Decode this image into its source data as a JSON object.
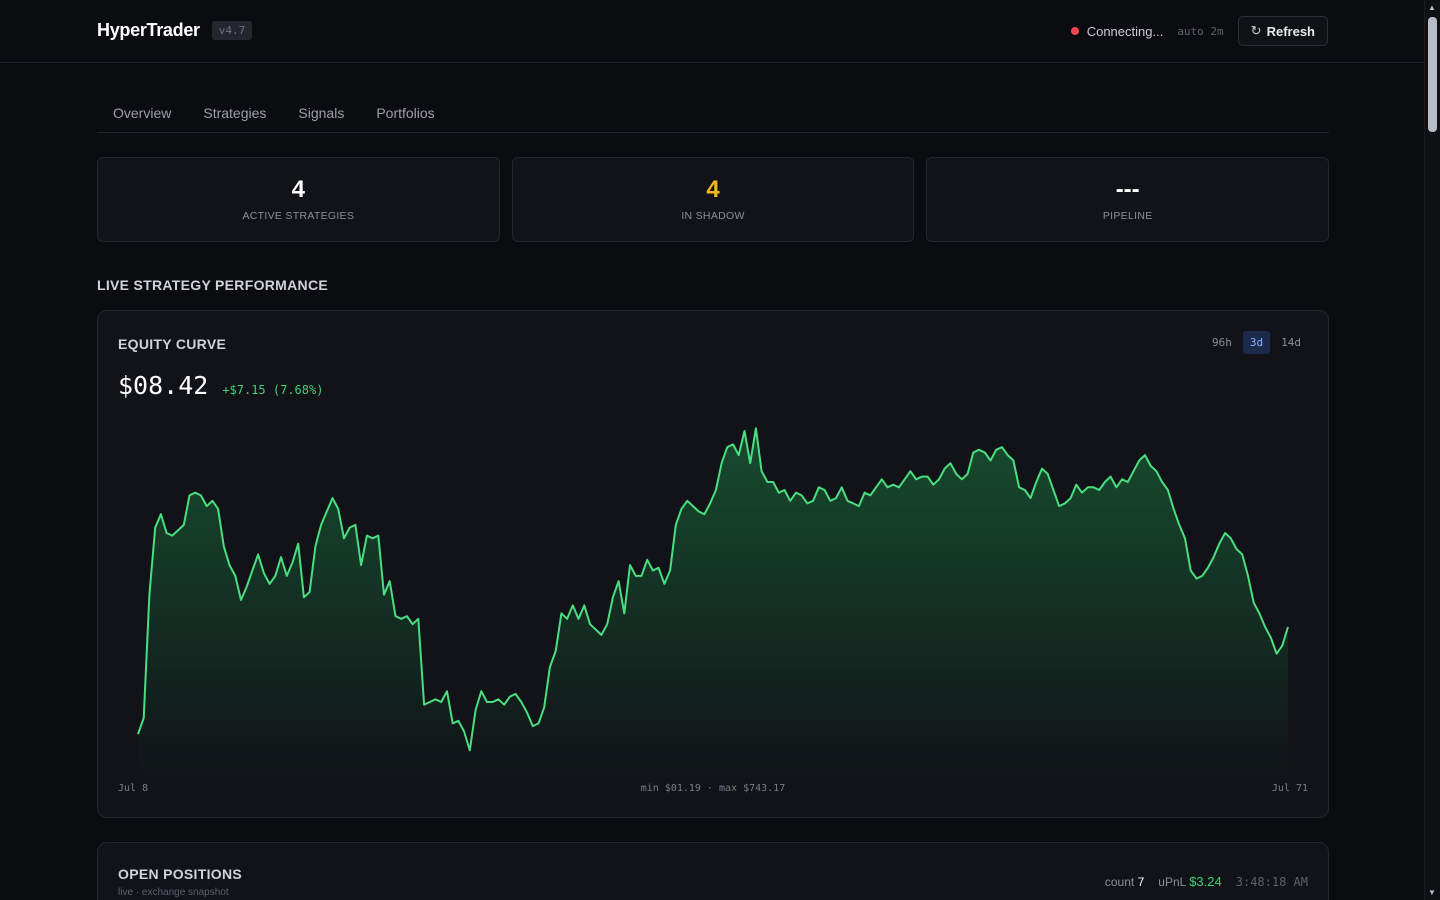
{
  "header": {
    "brand": "HyperTrader",
    "version": "v4.7",
    "status": "Connecting...",
    "auto": "auto 2m",
    "refresh_label": "Refresh",
    "refresh_icon": "refresh-icon"
  },
  "tabs": [
    {
      "label": "Overview",
      "active": true
    },
    {
      "label": "Strategies",
      "active": false
    },
    {
      "label": "Signals",
      "active": false
    },
    {
      "label": "Portfolios",
      "active": false
    }
  ],
  "stats": [
    {
      "value": "4",
      "label": "ACTIVE STRATEGIES",
      "color": "#ffffff"
    },
    {
      "value": "4",
      "label": "IN SHADOW",
      "color": "#f5b81b"
    },
    {
      "value": "---",
      "label": "PIPELINE",
      "color": "#ffffff"
    }
  ],
  "section_title": "LIVE STRATEGY PERFORMANCE",
  "equity": {
    "title": "EQUITY CURVE",
    "ranges": [
      {
        "label": "96h",
        "active": false
      },
      {
        "label": "3d",
        "active": true
      },
      {
        "label": "14d",
        "active": false
      }
    ],
    "amount": "$08.42",
    "change": "+$7.15 (7.68%)",
    "x_start": "Jul 8",
    "x_end": "Jul 71",
    "minmax": "min $01.19 · max $743.17",
    "accent": "#4ade80"
  },
  "chart_data": {
    "type": "area",
    "title": "EQUITY CURVE",
    "x_start": "Jul 8",
    "x_end": "Jul 71",
    "y_min": 0,
    "y_max": 100,
    "grid": false,
    "values": [
      10,
      16,
      62,
      87,
      92,
      85,
      84,
      86,
      88,
      99,
      100,
      99,
      95,
      97,
      94,
      80,
      73,
      69,
      60,
      65,
      71,
      77,
      70,
      66,
      69,
      76,
      69,
      74,
      81,
      61,
      63,
      80,
      88,
      93,
      98,
      94,
      83,
      87,
      88,
      73,
      84,
      83,
      84,
      62,
      67,
      54,
      53,
      54,
      51,
      53,
      21,
      22,
      23,
      22,
      26,
      14,
      15,
      11,
      4,
      19,
      26,
      22,
      22,
      23,
      21,
      24,
      25,
      22,
      18,
      13,
      14,
      20,
      35,
      41,
      55,
      53,
      58,
      53,
      58,
      51,
      49,
      47,
      51,
      61,
      67,
      55,
      73,
      69,
      69,
      75,
      71,
      72,
      66,
      71,
      88,
      94,
      97,
      95,
      93,
      92,
      96,
      101,
      111,
      117,
      118,
      114,
      123,
      111,
      124,
      108,
      104,
      104,
      100,
      101,
      97,
      100,
      99,
      96,
      97,
      102,
      101,
      97,
      98,
      102,
      97,
      96,
      95,
      100,
      99,
      102,
      105,
      102,
      103,
      102,
      105,
      108,
      105,
      106,
      106,
      103,
      105,
      109,
      111,
      107,
      105,
      107,
      115,
      116,
      115,
      112,
      116,
      117,
      114,
      112,
      102,
      101,
      98,
      104,
      109,
      107,
      101,
      95,
      96,
      98,
      103,
      100,
      102,
      102,
      101,
      104,
      106,
      102,
      105,
      104,
      108,
      112,
      114,
      110,
      108,
      104,
      101,
      94,
      88,
      83,
      71,
      68,
      69,
      72,
      76,
      81,
      85,
      83,
      79,
      77,
      69,
      59,
      55,
      50,
      46,
      40,
      43,
      50
    ]
  },
  "positions": {
    "title": "OPEN POSITIONS",
    "subtitle": "live · exchange snapshot",
    "count_label": "count",
    "count": "7",
    "upnl_label": "uPnL",
    "upnl": "$3.24",
    "time": "3:48:18 AM"
  }
}
